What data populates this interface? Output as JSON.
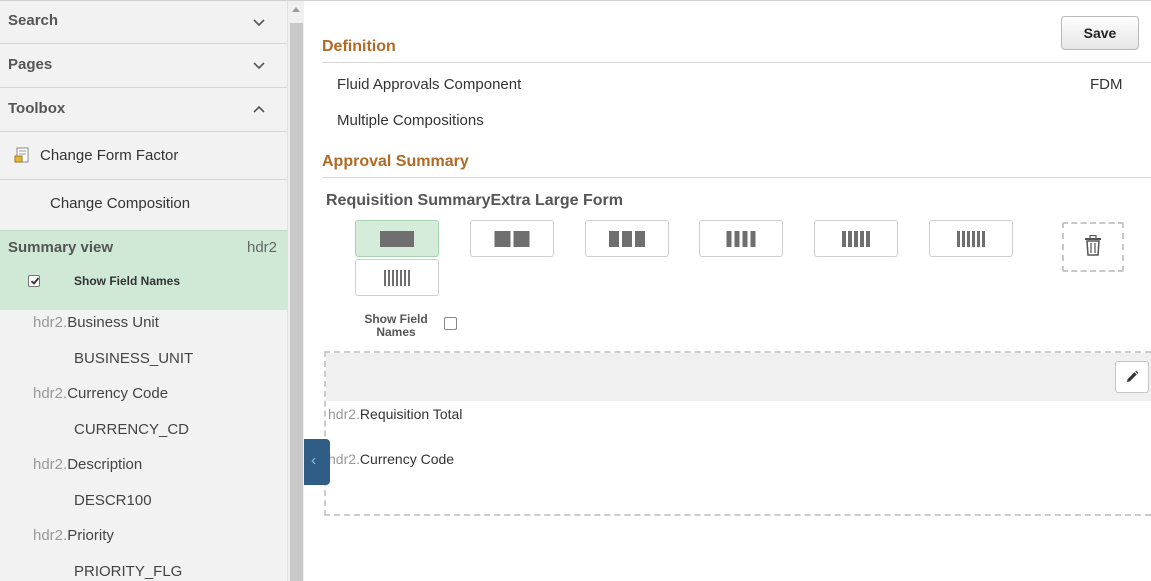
{
  "sidebar": {
    "accordions": [
      {
        "title": "Search",
        "state": "collapsed"
      },
      {
        "title": "Pages",
        "state": "collapsed"
      },
      {
        "title": "Toolbox",
        "state": "expanded"
      }
    ],
    "toolbox": {
      "change_form_factor": "Change Form Factor",
      "change_composition": "Change Composition"
    },
    "summary_view": {
      "title": "Summary view",
      "tag": "hdr2",
      "show_field_names_label": "Show Field Names",
      "show_field_names_checked": true
    },
    "fields": [
      {
        "prefix": "hdr2.",
        "label": "Business Unit",
        "name": "BUSINESS_UNIT"
      },
      {
        "prefix": "hdr2.",
        "label": "Currency Code",
        "name": "CURRENCY_CD"
      },
      {
        "prefix": "hdr2.",
        "label": "Description",
        "name": "DESCR100"
      },
      {
        "prefix": "hdr2.",
        "label": "Priority",
        "name": "PRIORITY_FLG"
      }
    ]
  },
  "main": {
    "save_label": "Save",
    "definition": {
      "title": "Definition",
      "component": "Fluid Approvals Component",
      "component_code": "FDM",
      "compositions": "Multiple Compositions"
    },
    "approval_summary": {
      "title": "Approval Summary",
      "subtitle": "Requisition SummaryExtra Large Form",
      "layouts": [
        {
          "columns": 1,
          "selected": true
        },
        {
          "columns": 2,
          "selected": false
        },
        {
          "columns": 3,
          "selected": false
        },
        {
          "columns": 4,
          "selected": false
        },
        {
          "columns": 5,
          "selected": false
        },
        {
          "columns": 6,
          "selected": false
        },
        {
          "columns": 7,
          "selected": false
        }
      ],
      "show_field_names_line1": "Show Field",
      "show_field_names_line2": "Names",
      "show_field_names_checked": false,
      "drop_fields": [
        {
          "prefix": "hdr2.",
          "label": "Requisition Total"
        },
        {
          "prefix": "hdr2.",
          "label": "Currency Code"
        }
      ]
    }
  },
  "icons": {
    "chevron": "chevron-icon",
    "form_factor": "form-factor-icon",
    "trash": "trash-icon",
    "pencil": "pencil-icon",
    "collapse": "chevron-left-icon"
  },
  "colors": {
    "section_title": "#b06a25",
    "selected_bg": "#d4ecd9",
    "summary_bg": "#cfe9d6",
    "collapse_tab": "#2f5d86"
  }
}
